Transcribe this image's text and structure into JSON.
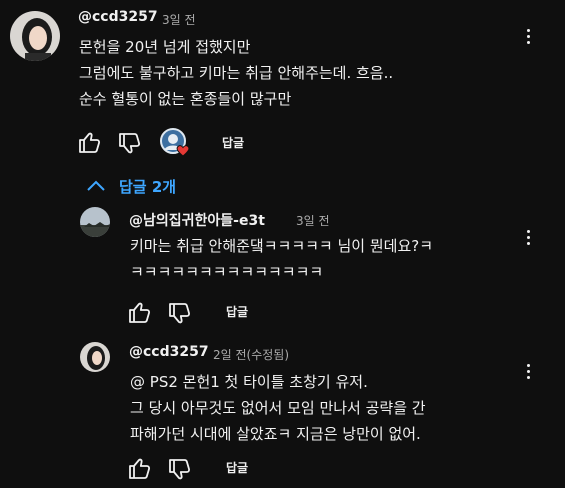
{
  "icons": [
    "thumb-up-icon",
    "thumb-down-icon",
    "more-vert-icon",
    "chevron-up-icon",
    "heart-icon"
  ],
  "colors": {
    "background": "#0f0f0f",
    "link": "#3ea6ff",
    "heart": "#e53935"
  },
  "comment": {
    "author": "@ccd3257",
    "time": "3일 전",
    "lines": [
      "몬헌을 20년 넘게 접했지만",
      "그럼에도 불구하고 키마는 취급 안해주는데. 흐음..",
      "순수 혈통이 없는 혼종들이 많구만"
    ],
    "reply_label": "답글"
  },
  "replies_toggle": {
    "label": "답글 2개"
  },
  "replies": [
    {
      "author": "@남의집귀한아들-e3t",
      "time": "3일 전",
      "lines": [
        "키마는 취급 안해준댘ㅋㅋㅋㅋㅋ 님이 뭔데요?ㅋ",
        "ㅋㅋㅋㅋㅋㅋㅋㅋㅋㅋㅋㅋㅋㅋ"
      ],
      "reply_label": "답글"
    },
    {
      "author": "@ccd3257",
      "time": "2일 전(수정됨)",
      "lines": [
        "@ PS2 몬헌1 첫 타이틀 초창기 유저.",
        "그 당시 아무것도 없어서 모임 만나서 공략을 간",
        "파해가던 시대에 살았죠ㅋ 지금은 낭만이 없어."
      ],
      "reply_label": "답글"
    }
  ]
}
